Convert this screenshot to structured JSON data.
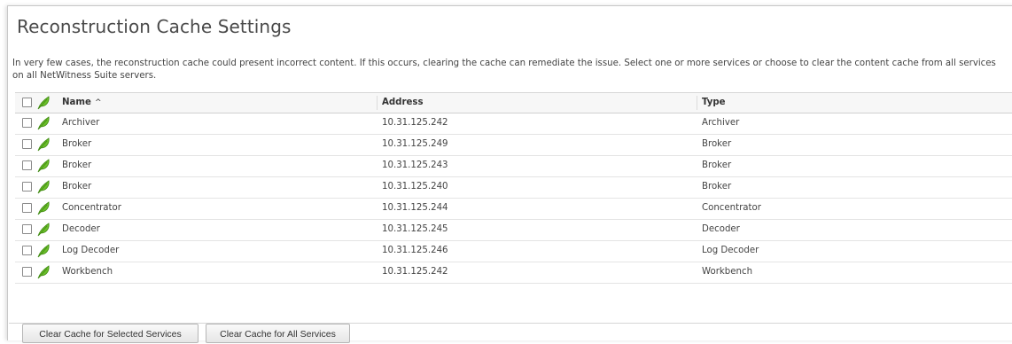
{
  "page": {
    "title": "Reconstruction Cache Settings",
    "description": "In very few cases, the reconstruction cache could present incorrect content. If this occurs, clearing the cache can remediate the issue. Select one or more services or choose to clear the content cache from all services on all NetWitness Suite servers."
  },
  "grid": {
    "columns": {
      "name": "Name",
      "address": "Address",
      "type": "Type"
    },
    "sort_indicator": "^",
    "rows": [
      {
        "name": "Archiver",
        "address": "10.31.125.242",
        "type": "Archiver"
      },
      {
        "name": "Broker",
        "address": "10.31.125.249",
        "type": "Broker"
      },
      {
        "name": "Broker",
        "address": "10.31.125.243",
        "type": "Broker"
      },
      {
        "name": "Broker",
        "address": "10.31.125.240",
        "type": "Broker"
      },
      {
        "name": "Concentrator",
        "address": "10.31.125.244",
        "type": "Concentrator"
      },
      {
        "name": "Decoder",
        "address": "10.31.125.245",
        "type": "Decoder"
      },
      {
        "name": "Log Decoder",
        "address": "10.31.125.246",
        "type": "Log Decoder"
      },
      {
        "name": "Workbench",
        "address": "10.31.125.242",
        "type": "Workbench"
      }
    ]
  },
  "buttons": {
    "clear_selected": "Clear Cache for Selected Services",
    "clear_all": "Clear Cache for All Services"
  },
  "icons": {
    "row_status": "leaf-icon",
    "leaf_color": "#6cbf2a"
  }
}
